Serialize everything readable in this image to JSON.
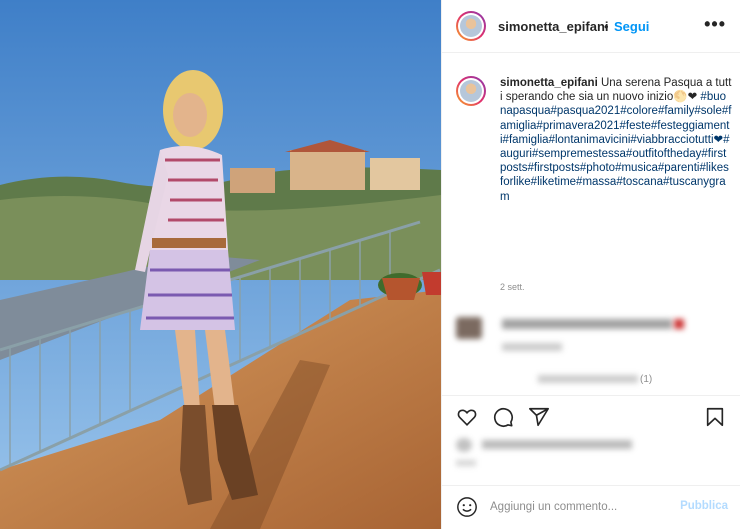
{
  "post": {
    "username": "simonetta_epifani",
    "separator": "•",
    "follow_label": "Segui",
    "more_icon": "more-options-icon"
  },
  "caption": {
    "username": "simonetta_epifani",
    "text": "Una serena Pasqua a tutti sperando che sia un nuovo inizio🌕❤",
    "hashtags": "#buonapasqua#pasqua2021#colore#family#sole#famiglia#primavera2021#feste#festeggiamenti#famiglia#lontanimavicini#viabbracciotutti❤#auguri#sempremestessa#outfitoftheday#firstposts#firstposts#photo#musica#parenti#likesforlike#liketime#massa#toscana#tuscanygram",
    "time": "2 sett."
  },
  "comments": {
    "blurred_reply_count": "(1)"
  },
  "actions": {
    "like_icon": "heart-icon",
    "comment_icon": "comment-icon",
    "share_icon": "paper-plane-icon",
    "save_icon": "bookmark-icon"
  },
  "add_comment": {
    "placeholder": "Aggiungi un commento...",
    "publish_label": "Pubblica",
    "emoji_icon": "smiley-icon"
  },
  "colors": {
    "accent": "#0095f6",
    "link": "#00376b",
    "muted": "#8e8e8e",
    "publish_disabled": "#b3dbff"
  }
}
